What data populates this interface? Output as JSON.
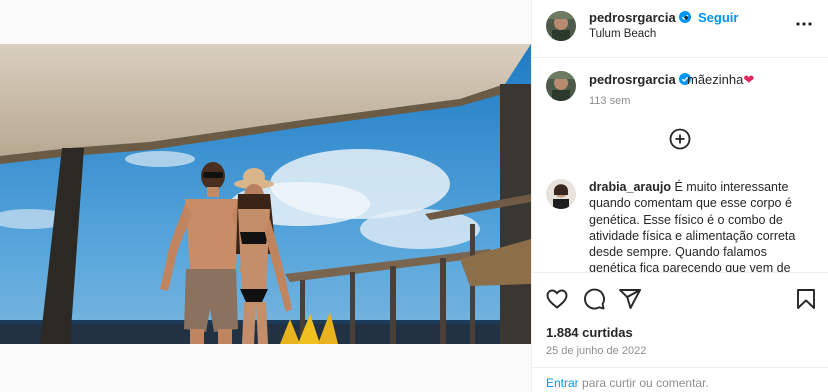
{
  "post": {
    "username": "pedrosrgarcia",
    "separator": "•",
    "follow_label": "Seguir",
    "location": "Tulum Beach",
    "caption": "mãezinha",
    "caption_emoji": "❤",
    "caption_time": "113 sem"
  },
  "comment": {
    "username": "drabia_araujo",
    "text": "É muito interessante quando comentam que esse corpo é genética. Esse físico é o combo de atividade física e alimentação correta desde sempre. Quando falamos genética fica parecendo que vem de Deus e não"
  },
  "footer": {
    "likes": "1.884 curtidas",
    "date": "25 de junho de 2022",
    "login_link": "Entrar",
    "login_rest": "para curtir ou comentar."
  },
  "colors": {
    "accent": "#0095f6",
    "verified": "#0095f6",
    "heart": "#e0245e",
    "muted": "#8e8e8e"
  },
  "icons": [
    "verified-icon",
    "more-icon",
    "load-more-icon",
    "heart-icon",
    "comment-icon",
    "share-icon",
    "bookmark-icon",
    "user-tag-icon"
  ]
}
